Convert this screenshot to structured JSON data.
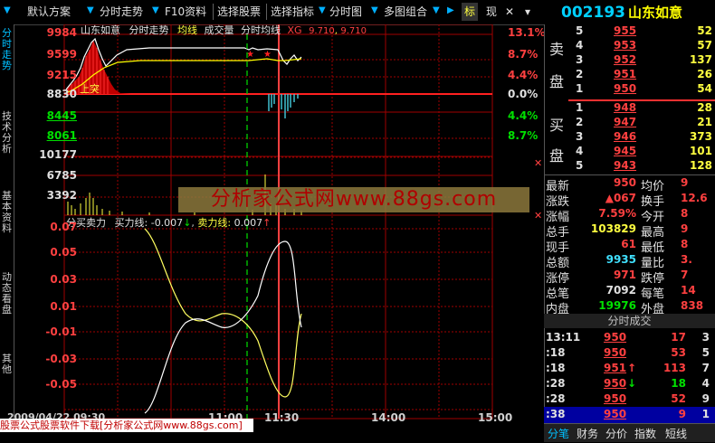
{
  "toolbar": {
    "default_scheme": "默认方案",
    "intraday": "分时走势",
    "f10": "F10资料",
    "pick_stock": "选择股票",
    "pick_indicator": "选择指标",
    "intraday_chart": "分时图",
    "multi_chart": "多图组合",
    "mark": "标",
    "now": "现"
  },
  "ticker": {
    "code": "002193",
    "name": "山东如意"
  },
  "left_tabs": [
    "分时走势",
    "技术分析",
    "基本资料",
    "动态看盘",
    "其他"
  ],
  "chart": {
    "header": {
      "name": "山东如意",
      "view": "分时走势",
      "avg": "均线",
      "vol": "成交量",
      "avgline": "分时均线",
      "xg": "XG",
      "xg_v1": "9.710",
      "xg_v2": "9.710"
    },
    "price_labels": [
      {
        "v": "9984",
        "c": "#ff4040"
      },
      {
        "v": "9599",
        "c": "#ff4040"
      },
      {
        "v": "9215",
        "c": "#ff4040"
      },
      {
        "v": "8830",
        "c": "#e0e0e0"
      },
      {
        "v": "8445",
        "c": "#00e000"
      },
      {
        "v": "8061",
        "c": "#00e000"
      }
    ],
    "pct_labels": [
      {
        "v": "13.1%",
        "c": "#ff4040"
      },
      {
        "v": "8.7%",
        "c": "#ff4040"
      },
      {
        "v": "4.4%",
        "c": "#ff4040"
      },
      {
        "v": "0.0%",
        "c": "#e0e0e0"
      },
      {
        "v": "4.4%",
        "c": "#00e000"
      },
      {
        "v": "8.7%",
        "c": "#00e000"
      }
    ],
    "vol_labels": [
      "10177",
      "6785",
      "3392"
    ],
    "shangtu": "上突",
    "ind_header": {
      "name": "分买卖力",
      "buy_lbl": "买力线:",
      "buy_val": "-0.007",
      "sell_lbl": "卖力线:",
      "sell_val": "0.007"
    },
    "ind_labels": [
      "0.07",
      "0.05",
      "0.03",
      "0.01",
      "-0.01",
      "-0.03",
      "-0.05"
    ],
    "time_labels": [
      "2009/04/22 09:30",
      "11:00",
      "11:30",
      "14:00",
      "15:00"
    ],
    "watermark": "分析家公式网www.88gs.com",
    "footer": "股票公式股票软件下载[分析家公式网www.88gs.com]"
  },
  "orderbook": {
    "sell_label": [
      "卖",
      "盘"
    ],
    "buy_label": [
      "买",
      "盘"
    ],
    "sell": [
      {
        "lvl": "5",
        "price": "955",
        "vol": "52"
      },
      {
        "lvl": "4",
        "price": "953",
        "vol": "57"
      },
      {
        "lvl": "3",
        "price": "952",
        "vol": "137"
      },
      {
        "lvl": "2",
        "price": "951",
        "vol": "26"
      },
      {
        "lvl": "1",
        "price": "950",
        "vol": "54"
      }
    ],
    "buy": [
      {
        "lvl": "1",
        "price": "948",
        "vol": "28"
      },
      {
        "lvl": "2",
        "price": "947",
        "vol": "21"
      },
      {
        "lvl": "3",
        "price": "946",
        "vol": "373"
      },
      {
        "lvl": "4",
        "price": "945",
        "vol": "101"
      },
      {
        "lvl": "5",
        "price": "943",
        "vol": "128"
      }
    ]
  },
  "stats": [
    {
      "k1": "最新",
      "v1": "950",
      "c1": "#ff4040",
      "k2": "均价",
      "v2": "9"
    },
    {
      "k1": "涨跌",
      "v1": "▲067",
      "c1": "#ff4040",
      "k2": "换手",
      "v2": "12.6"
    },
    {
      "k1": "涨幅",
      "v1": "7.59%",
      "c1": "#ff4040",
      "k2": "今开",
      "v2": "8"
    },
    {
      "k1": "总手",
      "v1": "103829",
      "c1": "#ffff40",
      "k2": "最高",
      "v2": "9"
    },
    {
      "k1": "现手",
      "v1": "61",
      "c1": "#ff4040",
      "k2": "最低",
      "v2": "8"
    },
    {
      "k1": "总额",
      "v1": "9935",
      "c1": "#40e0ff",
      "k2": "量比",
      "v2": "3."
    },
    {
      "k1": "涨停",
      "v1": "971",
      "c1": "#ff4040",
      "k2": "跌停",
      "v2": "7"
    },
    {
      "k1": "总笔",
      "v1": "7092",
      "c1": "#e0e0e0",
      "k2": "每笔",
      "v2": "14"
    },
    {
      "k1": "内盘",
      "v1": "19976",
      "c1": "#00e000",
      "k2": "外盘",
      "v2": "838"
    }
  ],
  "trades_header": "分时成交",
  "trades": [
    {
      "t": "13:11",
      "p": "950",
      "arrow": "",
      "v": "17",
      "n": "3"
    },
    {
      "t": ":18",
      "p": "950",
      "arrow": "",
      "v": "53",
      "n": "5"
    },
    {
      "t": ":18",
      "p": "951",
      "arrow": "↑",
      "v": "113",
      "n": "7"
    },
    {
      "t": ":28",
      "p": "950",
      "arrow": "↓",
      "v": "18",
      "n": "4"
    },
    {
      "t": ":28",
      "p": "950",
      "arrow": "",
      "v": "52",
      "n": "9"
    },
    {
      "t": ":38",
      "p": "950",
      "arrow": "",
      "v": "9",
      "n": "1"
    }
  ],
  "right_tabs": [
    "分笔",
    "财务",
    "分价",
    "指数",
    "短线"
  ]
}
